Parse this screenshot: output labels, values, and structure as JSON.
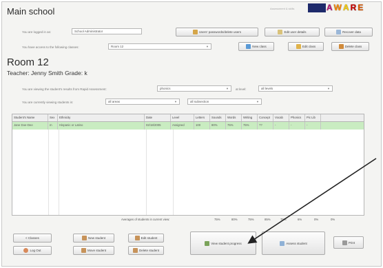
{
  "app": {
    "title": "Main school",
    "small_brand": "Assessment & skills",
    "logo": [
      "A",
      "W",
      "A",
      "R",
      "E"
    ]
  },
  "header": {
    "logged_in_label": "You are logged in as:",
    "logged_in_value": "School Administrator",
    "access_label": "You have access to the following classes:",
    "access_value": "Room 12",
    "users_button": "Users' passwords/delete users",
    "edit_user_button": "Edit user details",
    "recover_button": "Recover data",
    "new_class_button": "New class",
    "edit_class_button": "Edit class",
    "delete_class_button": "Delete class"
  },
  "class": {
    "name": "Room 12",
    "teacher": "Teacher: Jenny Smith   Grade: k",
    "results_label": "You are viewing the student's results from Rapid Assessment:",
    "results_value": "phonics",
    "level_label": "at level:",
    "level_value": "all levels",
    "viewing_label": "You are currently viewing students in:",
    "viewing_value": "all areas",
    "subsection_value": "all subsection"
  },
  "table": {
    "columns": [
      "Student's Name",
      "Sex",
      "Ethnicity",
      "Date",
      "Level",
      "Letters",
      "Sounds",
      "Words",
      "Writing",
      "Concept",
      "Vocab",
      "Phonics",
      "Pic Lib"
    ],
    "rows": [
      [
        "Jane Doe-Dee",
        "m",
        "Hispanic or Latino",
        "02/18/2005",
        "Assigned",
        "100",
        "80%",
        "75%",
        "75%",
        "??",
        "-",
        "-",
        "-"
      ]
    ],
    "averages_label": "Averages of students in current view:",
    "averages": [
      "75%",
      "80%",
      "75%",
      "85%",
      "75%",
      "6%",
      "0%",
      "0%"
    ]
  },
  "footer": {
    "classes_button": "< Classes",
    "logout_button": "Log Out",
    "new_student_button": "New student",
    "move_student_button": "Move student",
    "edit_student_button": "Edit student",
    "delete_student_button": "Delete student",
    "view_progress_button": "View student progress",
    "assess_button": "Assess student",
    "print_button": "Print"
  }
}
